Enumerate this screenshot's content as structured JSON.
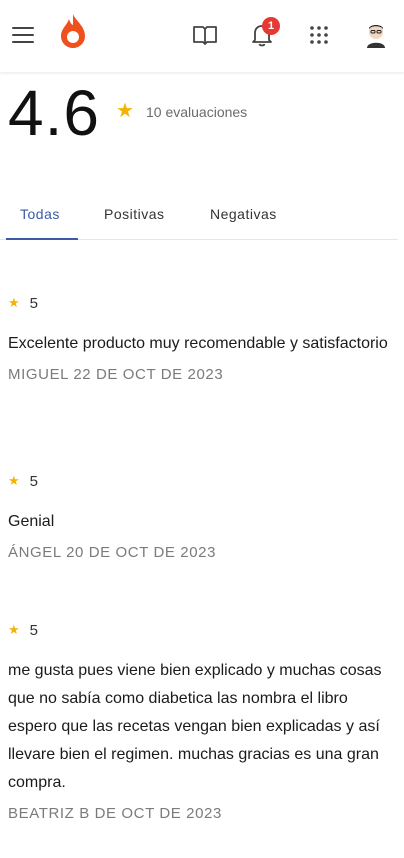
{
  "header": {
    "notification_count": "1",
    "icons": [
      "menu-icon",
      "brand-logo-icon",
      "book-icon",
      "bell-icon",
      "apps-grid-icon",
      "avatar"
    ]
  },
  "rating": {
    "score": "4.6",
    "count_label": "10 evaluaciones"
  },
  "tabs": [
    {
      "label": "Todas",
      "active": true
    },
    {
      "label": "Positivas",
      "active": false
    },
    {
      "label": "Negativas",
      "active": false
    }
  ],
  "reviews": [
    {
      "stars": "5",
      "text": "Excelente producto muy recomendable y satisfactorio",
      "meta": "MIGUEL 22 DE OCT DE 2023"
    },
    {
      "stars": "5",
      "text": "Genial",
      "meta": "ÁNGEL 20 DE OCT DE 2023"
    },
    {
      "stars": "5",
      "text": "me gusta pues viene bien explicado y muchas cosas que no sabía como diabetica las nombra el libro espero que las recetas vengan bien explicadas y así llevare bien el regimen. muchas gracias es una gran compra.",
      "meta": "BEATRIZ B DE OCT DE 2023"
    }
  ],
  "colors": {
    "brand": "#f0501e",
    "accent": "#3d5aa8",
    "star": "#f5b301",
    "badge": "#e53935"
  }
}
